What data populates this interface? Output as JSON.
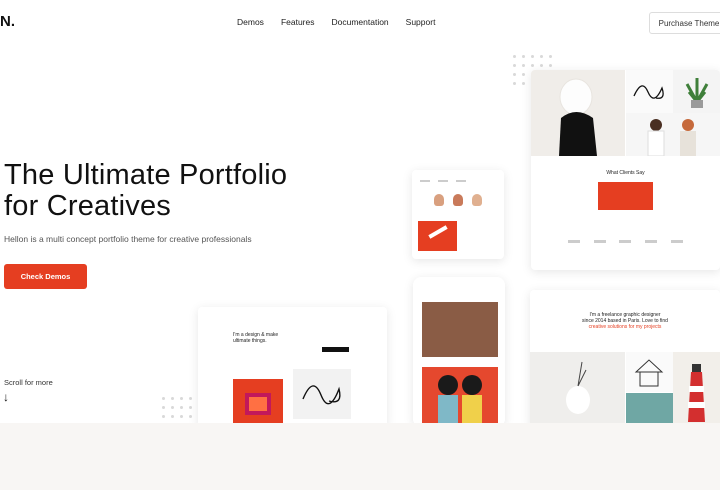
{
  "nav": {
    "logo": "N.",
    "links": [
      "Demos",
      "Features",
      "Documentation",
      "Support"
    ],
    "purchase_label": "Purchase Theme"
  },
  "hero": {
    "title_line1": "The Ultimate Portfolio",
    "title_line2": "for Creatives",
    "subtitle": "Hellon is a multi concept portfolio theme for creative professionals",
    "cta_label": "Check Demos",
    "scroll_label": "Scroll for more",
    "scroll_icon": "arrow-down-icon"
  },
  "previews": {
    "clients_heading": "What Clients Say",
    "designer_line1": "I'm a design & make",
    "designer_line2": "ultimate things.",
    "graphic_line1": "I'm a freelance graphic designer",
    "graphic_line2": "since 2014 based in Paris. Love to find",
    "graphic_line3": "creative solutions for my projects"
  },
  "colors": {
    "accent": "#e53e21",
    "footer_band": "#f8f6f4"
  }
}
